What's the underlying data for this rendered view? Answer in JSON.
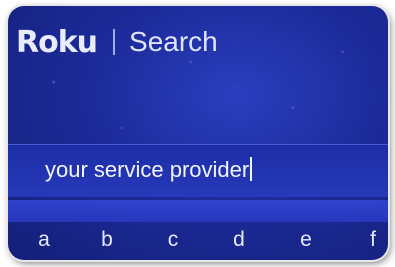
{
  "header": {
    "logo_text": "Roku",
    "title": "Search"
  },
  "search": {
    "query": "your service provider"
  },
  "keyboard": {
    "keys": [
      "a",
      "b",
      "c",
      "d",
      "e",
      "f"
    ]
  },
  "colors": {
    "background": "#1c2b9a",
    "text": "#e9ecff"
  }
}
